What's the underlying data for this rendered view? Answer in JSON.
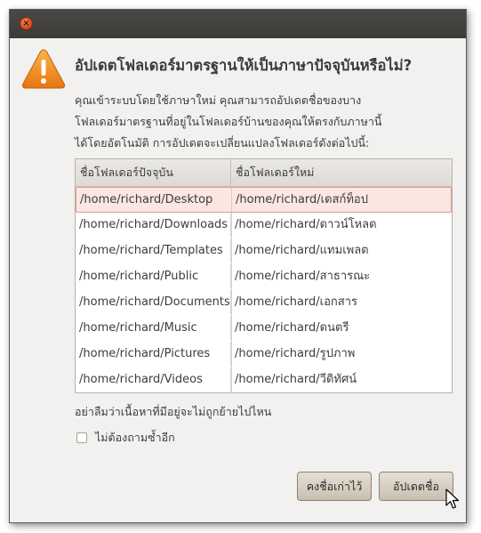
{
  "titlebar": {
    "close_icon": "close-icon",
    "close_glyph": "×"
  },
  "dialog": {
    "icon": "warning-icon",
    "headline": "อัปเดตโฟลเดอร์มาตรฐานให้เป็นภาษาปัจจุบันหรือไม่?",
    "body_lines": [
      "คุณเข้าระบบโดยใช้ภาษาใหม่ คุณสามารถอัปเดตชื่อของบาง",
      "โฟลเดอร์มาตรฐานที่อยู่ในโฟลเดอร์บ้านของคุณให้ตรงกับภาษานี้",
      "ได้โดยอัตโนมัติ การอัปเดตจะเปลี่ยนแปลงโฟลเดอร์ดังต่อไปนี้:"
    ],
    "table": {
      "headers": [
        "ชื่อโฟลเดอร์ปัจจุบัน",
        "ชื่อโฟลเดอร์ใหม่"
      ],
      "rows": [
        [
          "/home/richard/Desktop",
          "/home/richard/เดสก์ท็อป"
        ],
        [
          "/home/richard/Downloads",
          "/home/richard/ดาวน์โหลด"
        ],
        [
          "/home/richard/Templates",
          "/home/richard/แทมเพลต"
        ],
        [
          "/home/richard/Public",
          "/home/richard/สาธารณะ"
        ],
        [
          "/home/richard/Documents",
          "/home/richard/เอกสาร"
        ],
        [
          "/home/richard/Music",
          "/home/richard/ดนตรี"
        ],
        [
          "/home/richard/Pictures",
          "/home/richard/รูปภาพ"
        ],
        [
          "/home/richard/Videos",
          "/home/richard/วีดิทัศน์"
        ]
      ],
      "selected_row": 0
    },
    "note": "อย่าลืมว่าเนื้อหาที่มีอยู่จะไม่ถูกย้ายไปไหน",
    "checkbox": {
      "label": "ไม่ต้องถามซ้ำอีก",
      "checked": false
    },
    "buttons": {
      "keep_label": "คงชื่อเก่าไว้",
      "update_label": "อัปเดตชื่อ"
    }
  },
  "colors": {
    "titlebar": "#3b3a36",
    "dialog_bg": "#f2f1ef",
    "selected_row_bg": "#fbe6e1",
    "selected_row_border": "#e39a88",
    "warning_orange": "#f08c1e",
    "close_button": "#e0572a"
  }
}
